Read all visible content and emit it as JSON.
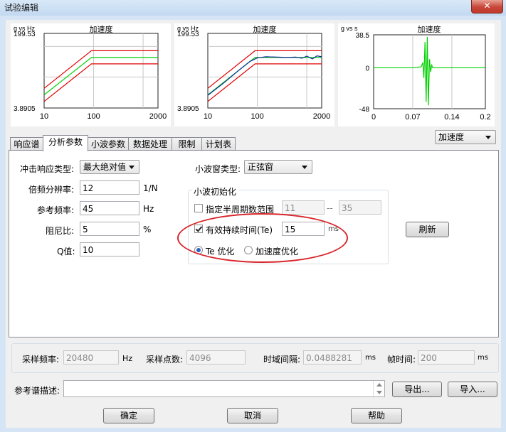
{
  "window": {
    "title": "试验编辑",
    "close": "✕"
  },
  "charts": [
    {
      "title": "加速度",
      "unit": "g vs Hz",
      "ymax": "199.53",
      "ymin": "3.8905",
      "xticks": [
        "10",
        "100",
        "2000"
      ]
    },
    {
      "title": "加速度",
      "unit": "g vs Hz",
      "ymax": "199.53",
      "ymin": "3.8905",
      "xticks": [
        "10",
        "100",
        "2000"
      ]
    },
    {
      "title": "加速度",
      "unit": "g vs s",
      "yticks": [
        "38.5",
        "0",
        "-48"
      ],
      "xticks": [
        "0",
        "0.07",
        "0.14",
        "0.2"
      ]
    }
  ],
  "chart_data": [
    {
      "type": "line",
      "title": "加速度",
      "xlabel": "g vs Hz",
      "xscale": "log",
      "yscale": "log",
      "xlim": [
        10,
        2000
      ],
      "ylim": [
        3.8905,
        199.53
      ],
      "series": [
        {
          "color": "#e00000",
          "x": [
            10,
            90,
            2000
          ],
          "y": [
            11,
            80,
            80
          ]
        },
        {
          "color": "#00d000",
          "x": [
            10,
            90,
            2000
          ],
          "y": [
            7.8,
            56,
            56
          ]
        },
        {
          "color": "#e00000",
          "x": [
            10,
            90,
            2000
          ],
          "y": [
            5.5,
            40,
            40
          ]
        }
      ]
    },
    {
      "type": "line",
      "title": "加速度",
      "xlabel": "g vs Hz",
      "xscale": "log",
      "yscale": "log",
      "xlim": [
        10,
        2000
      ],
      "ylim": [
        3.8905,
        199.53
      ],
      "series": [
        {
          "color": "#e00000",
          "x": [
            10,
            90,
            2000
          ],
          "y": [
            11,
            80,
            80
          ]
        },
        {
          "color": "#00d000",
          "x": [
            10,
            90,
            2000
          ],
          "y": [
            7.8,
            56,
            56
          ]
        },
        {
          "color": "#e00000",
          "x": [
            10,
            90,
            2000
          ],
          "y": [
            5.5,
            40,
            40
          ]
        },
        {
          "color": "#0a2a9a",
          "x": [
            10,
            20,
            40,
            70,
            100,
            150,
            250,
            400,
            600,
            800,
            1000,
            1300,
            1600,
            2000
          ],
          "y": [
            7.6,
            14,
            27,
            45,
            55,
            58,
            57,
            56,
            57,
            54,
            60,
            52,
            61,
            58
          ]
        }
      ]
    },
    {
      "type": "line",
      "title": "加速度",
      "xlabel": "g vs s",
      "xlim": [
        0,
        0.2
      ],
      "ylim": [
        -48,
        38.5
      ],
      "series": [
        {
          "color": "#00d000",
          "x": [
            0,
            0.07,
            0.085,
            0.088,
            0.09,
            0.092,
            0.094,
            0.096,
            0.098,
            0.1,
            0.102,
            0.104,
            0.106,
            0.11,
            0.2
          ],
          "y": [
            0,
            0,
            1,
            6,
            -12,
            30,
            -40,
            36,
            -44,
            10,
            -5,
            3,
            0,
            0,
            0
          ]
        }
      ]
    }
  ],
  "view_select": {
    "value": "加速度"
  },
  "tabs": [
    "响应谱",
    "分析参数",
    "小波参数",
    "数据处理",
    "限制",
    "计划表"
  ],
  "form": {
    "impulse_type_label": "冲击响应类型:",
    "impulse_type_value": "最大绝对值",
    "octave_label": "倍频分辨率:",
    "octave_value": "12",
    "octave_unit": "1/N",
    "ref_freq_label": "参考频率:",
    "ref_freq_value": "45",
    "ref_freq_unit": "Hz",
    "damping_label": "阻尼比:",
    "damping_value": "5",
    "damping_unit": "%",
    "q_label": "Q值:",
    "q_value": "10",
    "wavelet_window_label": "小波窗类型:",
    "wavelet_window_value": "正弦窗",
    "wavelet_init_title": "小波初始化",
    "half_period_label": "指定半周期数范围",
    "half_period_from": "11",
    "half_period_sep": "--",
    "half_period_to": "35",
    "te_label": "有效持续时间(Te)",
    "te_value": "15",
    "te_unit": "ms",
    "opt_te": "Te 优化",
    "opt_acc": "加速度优化",
    "refresh": "刷新"
  },
  "sampling": {
    "rate_label": "采样频率:",
    "rate_value": "20480",
    "rate_unit": "Hz",
    "points_label": "采样点数:",
    "points_value": "4096",
    "interval_label": "时域间隔:",
    "interval_value": "0.0488281",
    "interval_unit": "ms",
    "frame_label": "帧时间:",
    "frame_value": "200",
    "frame_unit": "ms"
  },
  "reference": {
    "label": "参考谱描述:",
    "value": "",
    "export": "导出...",
    "import": "导入..."
  },
  "buttons": {
    "ok": "确定",
    "cancel": "取消",
    "help": "帮助"
  },
  "colors": {
    "limit": "#e00000",
    "reference": "#00d000",
    "measured": "#0a2a9a",
    "highlight": "#d8242a"
  }
}
